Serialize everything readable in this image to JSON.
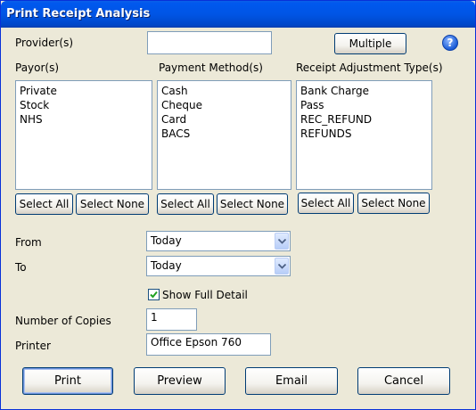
{
  "window": {
    "title": "Print Receipt Analysis"
  },
  "provider": {
    "label": "Provider(s)",
    "value": "",
    "multiple_label": "Multiple",
    "help_icon": "help-icon"
  },
  "payor": {
    "label": "Payor(s)",
    "items": [
      "Private",
      "Stock",
      "NHS"
    ],
    "select_all": "Select All",
    "select_none": "Select None"
  },
  "payment_method": {
    "label": "Payment Method(s)",
    "items": [
      "Cash",
      "Cheque",
      "Card",
      "BACS"
    ],
    "select_all": "Select All",
    "select_none": "Select None"
  },
  "adjustment_type": {
    "label": "Receipt Adjustment Type(s)",
    "items": [
      "Bank Charge",
      "Pass",
      "REC_REFUND",
      "REFUNDS"
    ],
    "select_all": "Select All",
    "select_none": "Select None"
  },
  "from": {
    "label": "From",
    "value": "Today"
  },
  "to": {
    "label": "To",
    "value": "Today"
  },
  "show_full_detail": {
    "label": "Show Full Detail",
    "checked": true
  },
  "copies": {
    "label": "Number of Copies",
    "value": "1"
  },
  "printer": {
    "label": "Printer",
    "value": "Office Epson 760"
  },
  "actions": {
    "print": "Print",
    "preview": "Preview",
    "email": "Email",
    "cancel": "Cancel"
  }
}
